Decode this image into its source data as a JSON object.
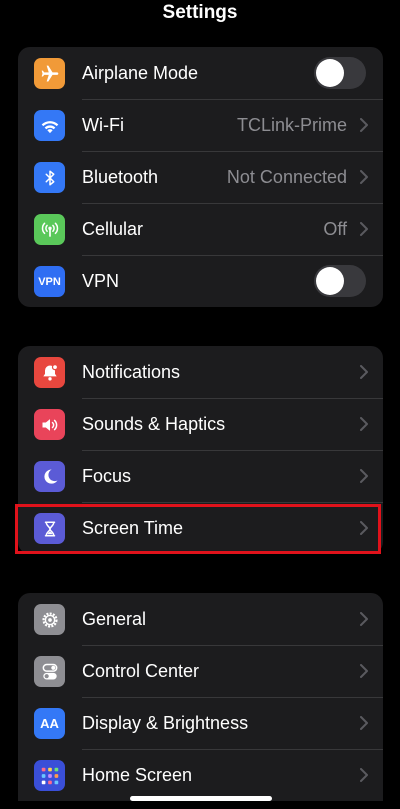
{
  "header": {
    "title": "Settings"
  },
  "groups": {
    "connectivity": [
      {
        "label": "Airplane Mode",
        "icon": "airplane-icon",
        "color": "#f19a38",
        "control": "toggle",
        "toggle_on": false
      },
      {
        "label": "Wi-Fi",
        "value": "TCLink-Prime",
        "icon": "wifi-icon",
        "color": "#3478f6"
      },
      {
        "label": "Bluetooth",
        "value": "Not Connected",
        "icon": "bluetooth-icon",
        "color": "#3478f6"
      },
      {
        "label": "Cellular",
        "value": "Off",
        "icon": "cellular-icon",
        "color": "#5ac85a"
      },
      {
        "label": "VPN",
        "icon_text": "VPN",
        "icon": "vpn-icon",
        "color": "#2f6ef3",
        "control": "toggle",
        "toggle_on": false
      }
    ],
    "notifications": [
      {
        "label": "Notifications",
        "icon": "bell-icon",
        "color": "#e8473e"
      },
      {
        "label": "Sounds & Haptics",
        "icon": "speaker-icon",
        "color": "#e9445a"
      },
      {
        "label": "Focus",
        "icon": "moon-icon",
        "color": "#5b5bd6"
      },
      {
        "label": "Screen Time",
        "icon": "hourglass-icon",
        "color": "#5b5bd6",
        "highlighted": true
      }
    ],
    "general": [
      {
        "label": "General",
        "icon": "gear-icon",
        "color": "#8e8e93"
      },
      {
        "label": "Control Center",
        "icon": "switches-icon",
        "color": "#8e8e93"
      },
      {
        "label": "Display & Brightness",
        "icon_text": "AA",
        "icon": "text-size-icon",
        "color": "#3478f6"
      },
      {
        "label": "Home Screen",
        "icon": "home-grid-icon",
        "color": "#3a4fd8"
      }
    ]
  },
  "colors": {
    "background": "#000000",
    "cell": "#1c1c1e",
    "separator": "#38383a",
    "secondary_text": "#8d8d92",
    "highlight_border": "#e0121b"
  }
}
